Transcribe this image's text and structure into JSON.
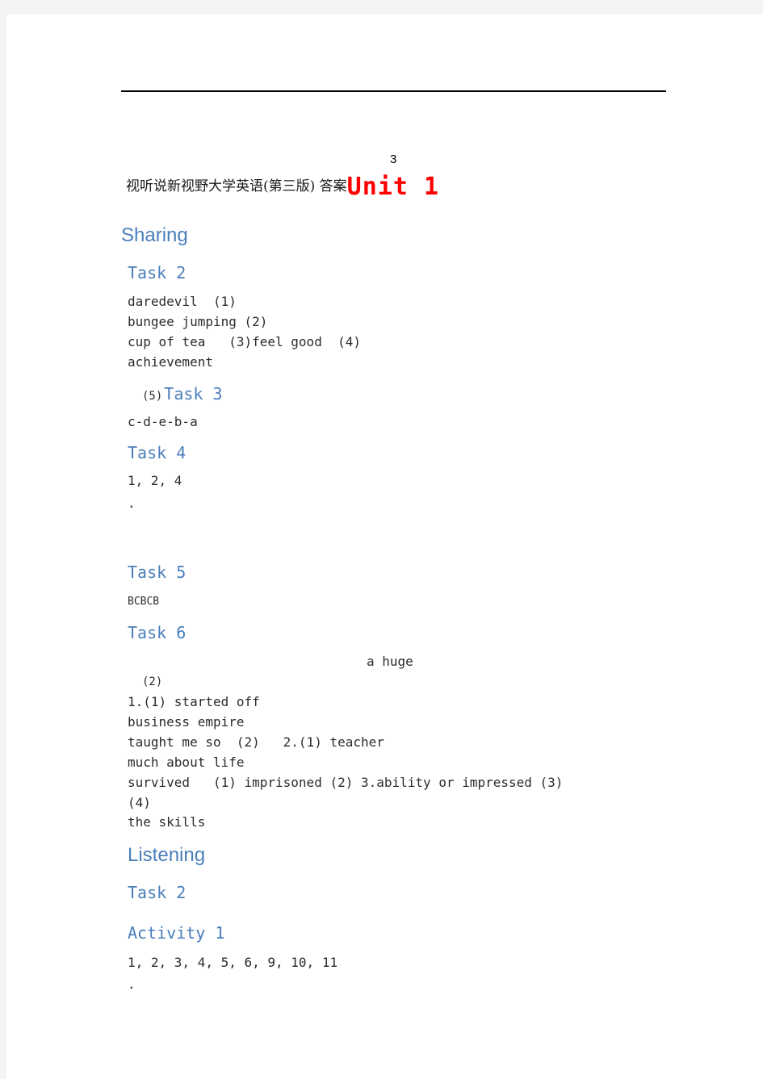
{
  "document": {
    "page_number": "3",
    "title_cn": "视听说新视野大学英语(第三版) 答案",
    "title_unit": "Unit 1",
    "accent_heading_color": "#4a7ebb",
    "accent_unit_color": "#ff0000"
  },
  "sections": [
    {
      "name": "sharing",
      "heading": "Sharing"
    },
    {
      "name": "listening",
      "heading": "Listening"
    }
  ],
  "headings": {
    "sharing": "Sharing",
    "listening": "Listening",
    "task_2": "Task 2",
    "task_3": "Task 3",
    "task_4": "Task 4",
    "task_5": "Task 5",
    "task_6": "Task 6",
    "listening_task_2": "Task 2",
    "activity_1": "Activity 1"
  },
  "answers": {
    "task_2": [
      "daredevil  (1)",
      "bungee jumping (2)",
      "cup of tea   (3)feel good  (4)",
      "achievement"
    ],
    "task_2_trailing_number": "(5)",
    "task_3": [
      "c-d-e-b-a"
    ],
    "task_4": [
      "1, 2, 4",
      "."
    ],
    "task_5": [
      "BCBCB"
    ],
    "task_6": [
      "a huge",
      "(2)",
      "1.(1) started off",
      "business empire",
      "taught me so  (2)   2.(1) teacher",
      "much about life",
      "survived   (1) imprisoned (2) 3.ability or impressed (3)",
      "(4)",
      "the skills"
    ],
    "activity_1": [
      "1, 2, 3, 4, 5, 6, 9, 10, 11",
      "."
    ]
  }
}
